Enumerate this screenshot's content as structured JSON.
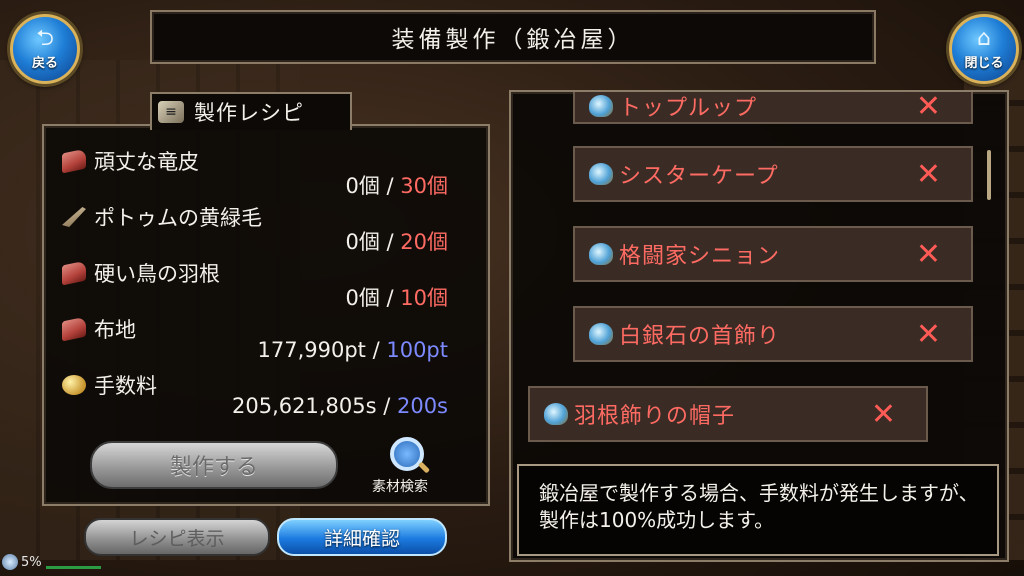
{
  "header": {
    "title": "装備製作（鍛冶屋）",
    "back_label": "戻る",
    "close_label": "閉じる"
  },
  "recipe": {
    "tab_label": "製作レシピ",
    "materials": [
      {
        "icon": "hide-icon",
        "name": "頑丈な竜皮",
        "have": "0個",
        "sep": " / ",
        "need": "30個",
        "need_color": "#ff6b63"
      },
      {
        "icon": "feather-icon",
        "name": "ポトゥムの黄緑毛",
        "have": "0個",
        "sep": " / ",
        "need": "20個",
        "need_color": "#ff6b63"
      },
      {
        "icon": "hide-icon",
        "name": "硬い鳥の羽根",
        "have": "0個",
        "sep": " / ",
        "need": "10個",
        "need_color": "#ff6b63"
      },
      {
        "icon": "hide-icon",
        "name": "布地",
        "have": "177,990pt",
        "sep": " / ",
        "need": "100pt",
        "need_color": "#7c89ff"
      },
      {
        "icon": "coin-icon",
        "name": "手数料",
        "have": "205,621,805s",
        "sep": " / ",
        "need": "200s",
        "need_color": "#7c89ff"
      }
    ],
    "craft_button": "製作する",
    "material_search_label": "素材検索",
    "recipe_view_button": "レシピ表示",
    "detail_button": "詳細確認"
  },
  "status": {
    "percent": "5%"
  },
  "item_list": {
    "items": [
      {
        "name": "トップルップ",
        "mark": "✕"
      },
      {
        "name": "シスターケープ",
        "mark": "✕"
      },
      {
        "name": "格闘家シニョン",
        "mark": "✕"
      },
      {
        "name": "白銀石の首飾り",
        "mark": "✕"
      },
      {
        "name": "羽根飾りの帽子",
        "mark": "✕"
      }
    ]
  },
  "description": "鍛冶屋で製作する場合、手数料が発生しますが、製作は100%成功します。"
}
